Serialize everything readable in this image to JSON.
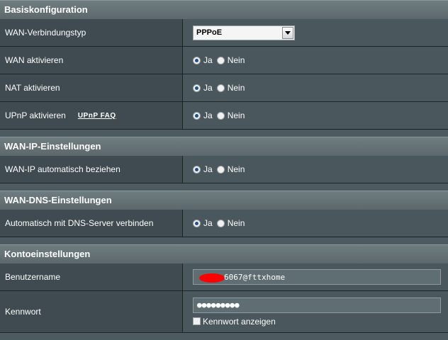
{
  "sections": {
    "basic": {
      "title": "Basiskonfiguration",
      "wan_type_label": "WAN-Verbindungstyp",
      "wan_type_value": "PPPoE",
      "wan_enable_label": "WAN aktivieren",
      "nat_enable_label": "NAT aktivieren",
      "upnp_enable_label": "UPnP aktivieren",
      "upnp_faq_link": "UPnP  FAQ"
    },
    "wan_ip": {
      "title": "WAN-IP-Einstellungen",
      "auto_ip_label": "WAN-IP automatisch beziehen"
    },
    "wan_dns": {
      "title": "WAN-DNS-Einstellungen",
      "auto_dns_label": "Automatisch mit DNS-Server verbinden"
    },
    "account": {
      "title": "Kontoeinstellungen",
      "username_label": "Benutzername",
      "username_value": "6067@fttxhome",
      "password_label": "Kennwort",
      "password_value": "●●●●●●●●●",
      "show_password_label": "Kennwort anzeigen"
    }
  },
  "radio": {
    "yes": "Ja",
    "no": "Nein"
  },
  "colors": {
    "radio_selected": "#1f4f8f",
    "redaction": "#ff0000"
  }
}
